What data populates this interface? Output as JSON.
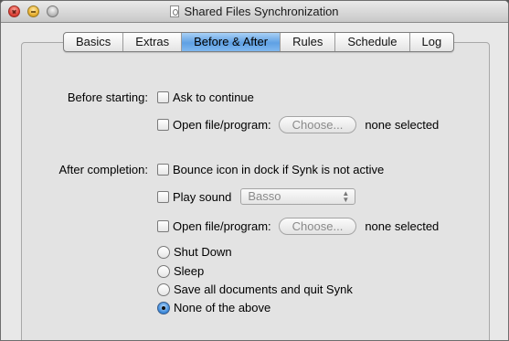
{
  "window": {
    "title": "Shared Files Synchronization"
  },
  "tabs": [
    {
      "label": "Basics",
      "active": false
    },
    {
      "label": "Extras",
      "active": false
    },
    {
      "label": "Before & After",
      "active": true
    },
    {
      "label": "Rules",
      "active": false
    },
    {
      "label": "Schedule",
      "active": false
    },
    {
      "label": "Log",
      "active": false
    }
  ],
  "before": {
    "section_label": "Before starting:",
    "ask_to_continue": {
      "label": "Ask to continue",
      "checked": false
    },
    "open_file": {
      "label": "Open file/program:",
      "checked": false,
      "button_label": "Choose...",
      "status": "none selected"
    }
  },
  "after": {
    "section_label": "After completion:",
    "bounce_icon": {
      "label": "Bounce icon in dock if Synk is not active",
      "checked": false
    },
    "play_sound": {
      "label": "Play sound",
      "checked": false,
      "selected_sound": "Basso"
    },
    "open_file": {
      "label": "Open file/program:",
      "checked": false,
      "button_label": "Choose...",
      "status": "none selected"
    },
    "radio_options": [
      {
        "label": "Shut Down",
        "selected": false
      },
      {
        "label": "Sleep",
        "selected": false
      },
      {
        "label": "Save all documents and quit Synk",
        "selected": false
      },
      {
        "label": "None of the above",
        "selected": true
      }
    ]
  },
  "colors": {
    "active_tab": "#5fa1e4",
    "window_bg": "#e8e8e8"
  }
}
